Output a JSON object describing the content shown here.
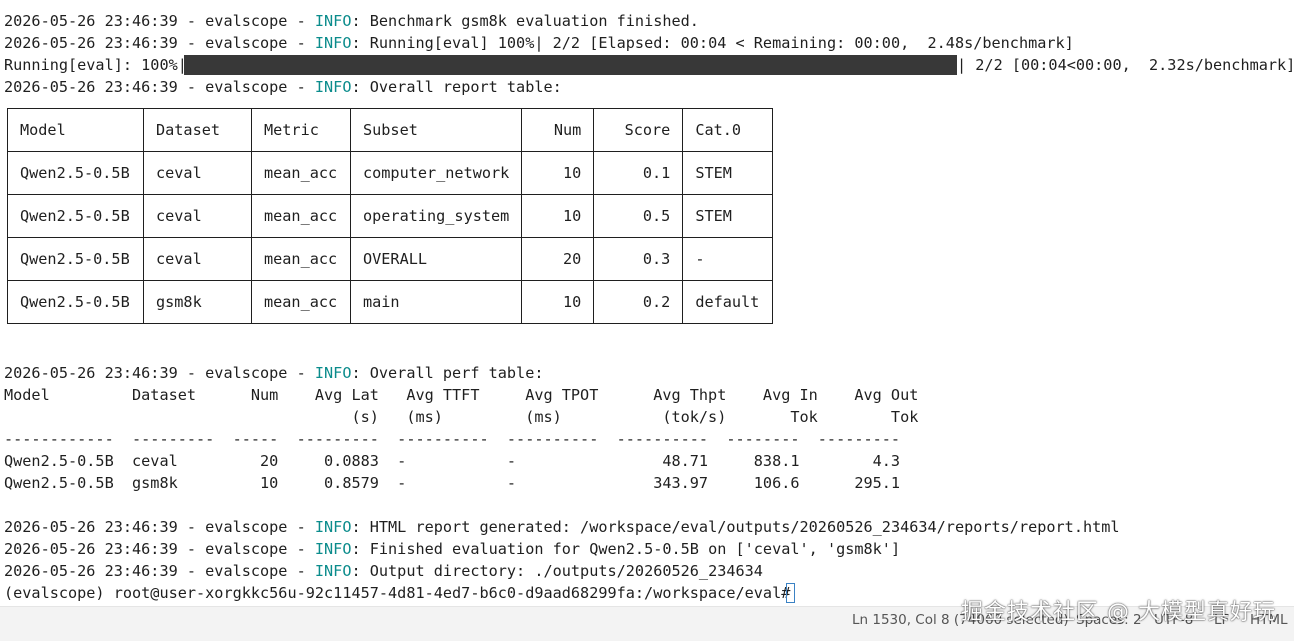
{
  "colors": {
    "info": "#0b8c8c",
    "text": "#1f1f1f",
    "progress_bar": "#383838",
    "cursor": "#3b82c4"
  },
  "log": {
    "line1": {
      "prefix": "2026-05-26 23:46:39 - evalscope - ",
      "level": "INFO",
      "message": ": Benchmark gsm8k evaluation finished."
    },
    "line2": {
      "prefix": "2026-05-26 23:46:39 - evalscope - ",
      "level": "INFO",
      "message": ": Running[eval] 100%| 2/2 [Elapsed: 00:04 < Remaining: 00:00,  2.48s/benchmark]"
    },
    "progress": {
      "label": "Running[eval]: 100%|",
      "value": 1.0,
      "suffix": "| 2/2 [00:04<00:00,  2.32s/benchmark]"
    },
    "line3": {
      "prefix": "2026-05-26 23:46:39 - evalscope - ",
      "level": "INFO",
      "message": ": Overall report table:"
    }
  },
  "report_table": {
    "headers": [
      "Model",
      "Dataset",
      "Metric",
      "Subset",
      "Num",
      "Score",
      "Cat.0"
    ],
    "rows": [
      [
        "Qwen2.5-0.5B",
        "ceval",
        "mean_acc",
        "computer_network",
        "10",
        "0.1",
        "STEM"
      ],
      [
        "Qwen2.5-0.5B",
        "ceval",
        "mean_acc",
        "operating_system",
        "10",
        "0.5",
        "STEM"
      ],
      [
        "Qwen2.5-0.5B",
        "ceval",
        "mean_acc",
        "OVERALL",
        "20",
        "0.3",
        "-"
      ],
      [
        "Qwen2.5-0.5B",
        "gsm8k",
        "mean_acc",
        "main",
        "10",
        "0.2",
        "default"
      ]
    ]
  },
  "perf": {
    "title": {
      "prefix": "2026-05-26 23:46:39 - evalscope - ",
      "level": "INFO",
      "message": ": Overall perf table:"
    },
    "header1": "Model         Dataset      Num    Avg Lat   Avg TTFT     Avg TPOT      Avg Thpt    Avg In    Avg Out",
    "header2": "                                      (s)   (ms)         (ms)           (tok/s)       Tok        Tok",
    "separator": "------------  ---------  -----  ---------  ----------  ----------  ----------  --------  ---------",
    "row1": "Qwen2.5-0.5B  ceval         20     0.0883  -           -                48.71     838.1        4.3",
    "row2": "Qwen2.5-0.5B  gsm8k         10     0.8579  -           -               343.97     106.6      295.1"
  },
  "tail": {
    "line1": {
      "prefix": "2026-05-26 23:46:39 - evalscope - ",
      "level": "INFO",
      "message": ": HTML report generated: /workspace/eval/outputs/20260526_234634/reports/report.html"
    },
    "line2": {
      "prefix": "2026-05-26 23:46:39 - evalscope - ",
      "level": "INFO",
      "message": ": Finished evaluation for Qwen2.5-0.5B on ['ceval', 'gsm8k']"
    },
    "line3": {
      "prefix": "2026-05-26 23:46:39 - evalscope - ",
      "level": "INFO",
      "message": ": Output directory: ./outputs/20260526_234634"
    },
    "prompt": "(evalscope) root@user-xorgkkc56u-92c11457-4d81-4ed7-b6c0-d9aad68299fa:/workspace/eval# "
  },
  "statusbar": {
    "position": "Ln 1530, Col 8 (74060 selected)",
    "spaces": "Spaces: 2",
    "encoding": "UTF-8",
    "eol": "LF",
    "language": "HTML"
  },
  "watermark": "掘金技术社区 @ 大模型真好玩"
}
